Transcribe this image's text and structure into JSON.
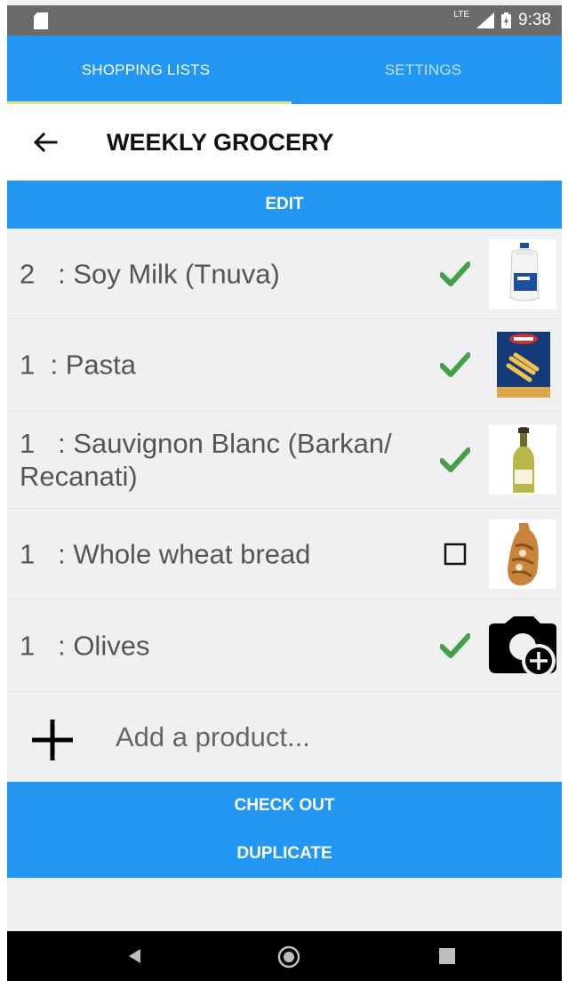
{
  "status_bar": {
    "network": "LTE",
    "time": "9:38"
  },
  "tabs": [
    {
      "label": "SHOPPING LISTS",
      "active": true
    },
    {
      "label": "SETTINGS",
      "active": false
    }
  ],
  "header": {
    "title": "WEEKLY GROCERY"
  },
  "edit_label": "EDIT",
  "items": [
    {
      "qty": "2",
      "name": ": Soy Milk (Tnuva)",
      "checked": true,
      "image": "milk-bottle-image"
    },
    {
      "qty": "1",
      "name": ": Pasta",
      "checked": true,
      "image": "pasta-box-image"
    },
    {
      "qty": "1",
      "name": ": Sauvignon Blanc (Barkan/ Recanati)",
      "checked": true,
      "image": "wine-bottle-image"
    },
    {
      "qty": "1",
      "name": ": Whole wheat bread",
      "checked": false,
      "image": "bread-loaf-image"
    },
    {
      "qty": "1",
      "name": ": Olives",
      "checked": true,
      "image": "add-photo-icon"
    }
  ],
  "add_product": {
    "placeholder": "Add a product..."
  },
  "actions": {
    "checkout_label": "CHECK OUT",
    "duplicate_label": "DUPLICATE"
  },
  "colors": {
    "primary": "#2196f3",
    "indicator": "#d8e98a",
    "check": "#43a047",
    "background": "#f0f0f2"
  }
}
